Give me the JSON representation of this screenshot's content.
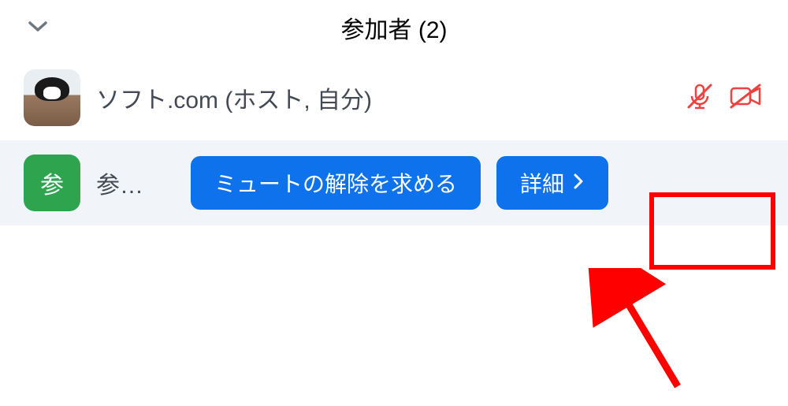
{
  "header": {
    "title": "参加者 (2)"
  },
  "participants": [
    {
      "avatar_type": "cat",
      "avatar_initial": "",
      "name": "ソフト.com (ホスト, 自分)",
      "mic_muted": true,
      "cam_off": true
    },
    {
      "avatar_type": "green",
      "avatar_initial": "参",
      "name": "参…"
    }
  ],
  "buttons": {
    "ask_unmute": "ミュートの解除を求める",
    "more": "詳細"
  },
  "icons": {
    "chevron_down": "chevron-down-icon",
    "mic_muted": "mic-muted-icon",
    "cam_off": "camera-off-icon",
    "chevron_right": "chevron-right-icon"
  },
  "colors": {
    "primary": "#0e72ed",
    "danger": "#f04141",
    "accent_green": "#2ea44f",
    "highlight_red": "#ff0000"
  }
}
